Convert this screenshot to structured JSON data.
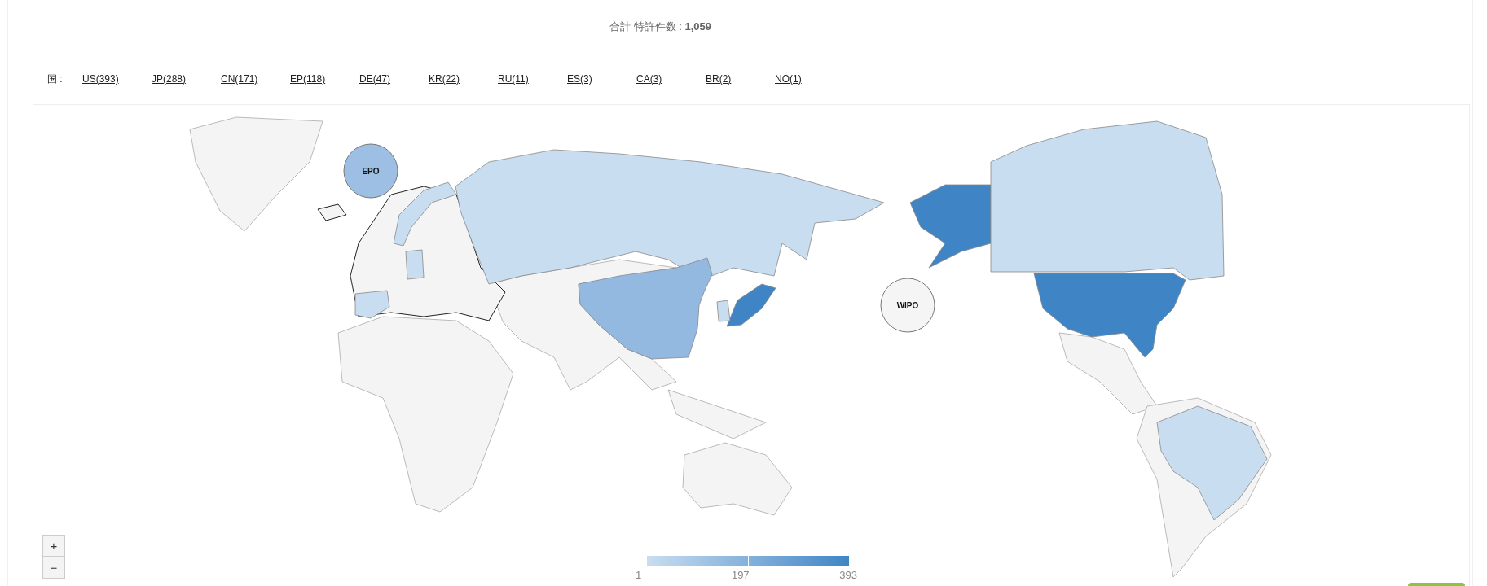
{
  "summary": {
    "label": "合計 特許件数 : ",
    "total": "1,059"
  },
  "country_filter": {
    "label": "国 :",
    "countries": [
      {
        "label": "US(393)"
      },
      {
        "label": "JP(288)"
      },
      {
        "label": "CN(171)"
      },
      {
        "label": "EP(118)"
      },
      {
        "label": "DE(47)"
      },
      {
        "label": "KR(22)"
      },
      {
        "label": "RU(11)"
      },
      {
        "label": "ES(3)"
      },
      {
        "label": "CA(3)"
      },
      {
        "label": "BR(2)"
      },
      {
        "label": "NO(1)"
      }
    ]
  },
  "map": {
    "regions": [
      {
        "color": "#3f85c6"
      },
      {
        "color": "#3f85c6"
      },
      {
        "color": "#93b9e0"
      },
      {
        "color": "#c9ddf0"
      },
      {
        "color": "#c9ddf0"
      },
      {
        "color": "#c9ddf0"
      },
      {
        "color": "#c9ddf0"
      },
      {
        "color": "#c9ddf0"
      },
      {
        "color": "#c9ddf0"
      },
      {
        "color": "#c9ddf0"
      }
    ],
    "bubbles": [
      {
        "label": "EPO",
        "color": "#9dbfe3"
      },
      {
        "label": "WIPO",
        "color": "#f5f5f5"
      }
    ]
  },
  "legend": {
    "min": "1",
    "mid": "197",
    "max": "393"
  },
  "zoom": {
    "in": "+",
    "out": "−"
  }
}
